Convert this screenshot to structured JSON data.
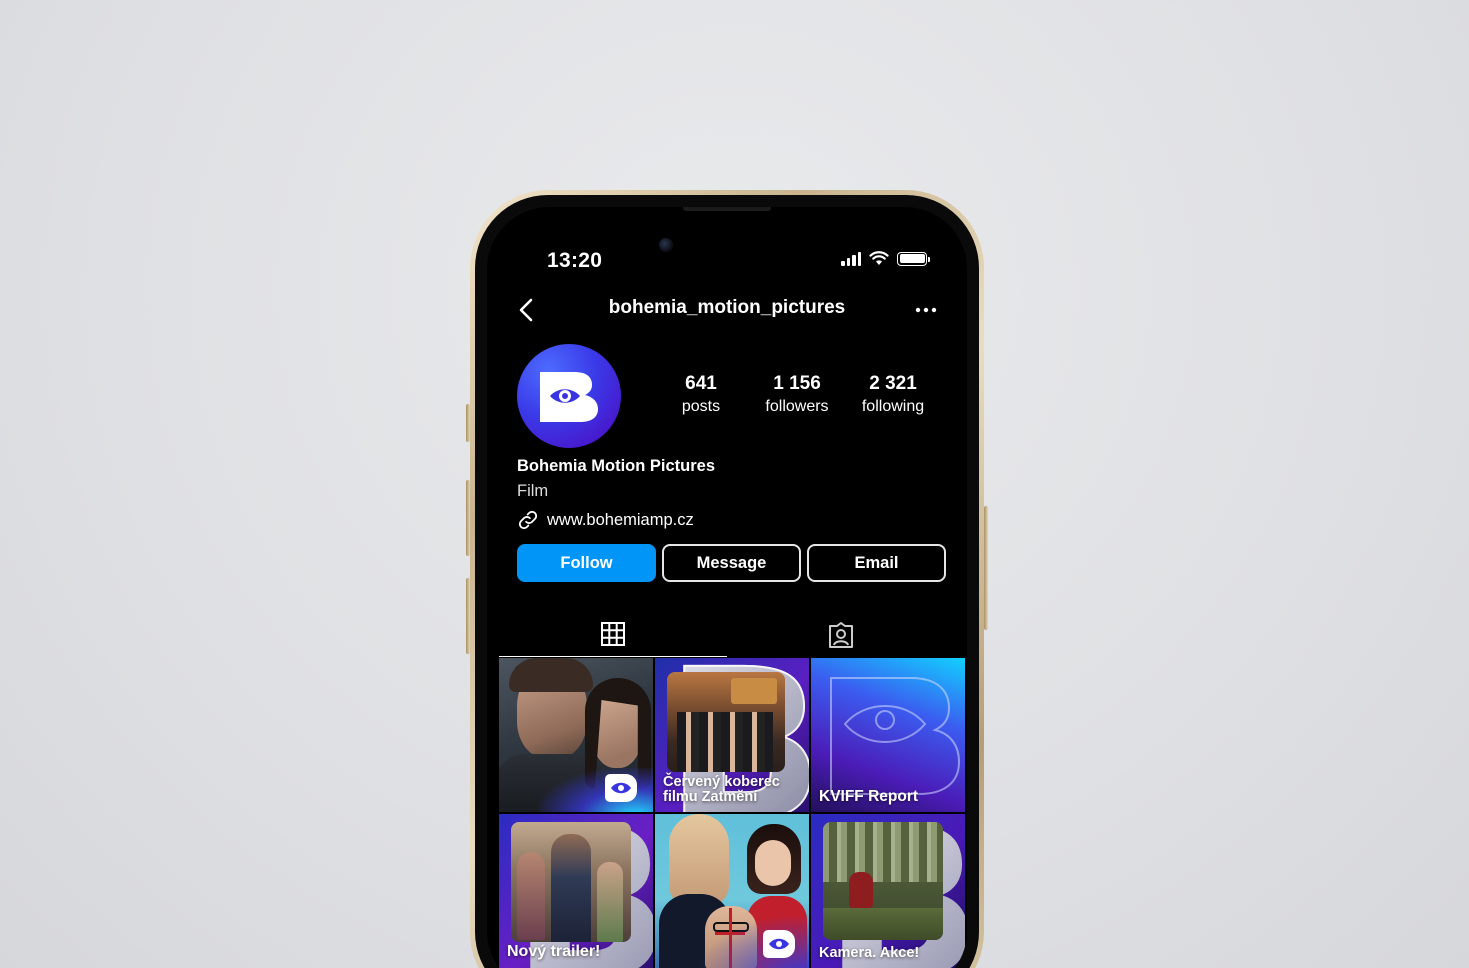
{
  "status_bar": {
    "time": "13:20"
  },
  "header": {
    "username": "bohemia_motion_pictures"
  },
  "stats": [
    {
      "value": "641",
      "label": "posts"
    },
    {
      "value": "1 156",
      "label": "followers"
    },
    {
      "value": "2 321",
      "label": "following"
    }
  ],
  "bio": {
    "name": "Bohemia Motion Pictures",
    "category": "Film",
    "link": "www.bohemiamp.cz"
  },
  "actions": {
    "follow": "Follow",
    "message": "Message",
    "email": "Email"
  },
  "tabs": {
    "grid_icon": "grid-icon",
    "tagged_icon": "tagged-person-icon"
  },
  "posts": [
    {
      "caption": ""
    },
    {
      "caption_line1": "Červený koberec",
      "caption_line2": "filmu Zatmění"
    },
    {
      "caption": "KVIFF Report"
    },
    {
      "caption": "Nový trailer!"
    },
    {
      "caption": ""
    },
    {
      "caption": "Kamera. Akce!"
    }
  ],
  "colors": {
    "accent": "#0095f6",
    "brand_blue": "#3a3ae8",
    "brand_purple": "#4a14c9"
  }
}
